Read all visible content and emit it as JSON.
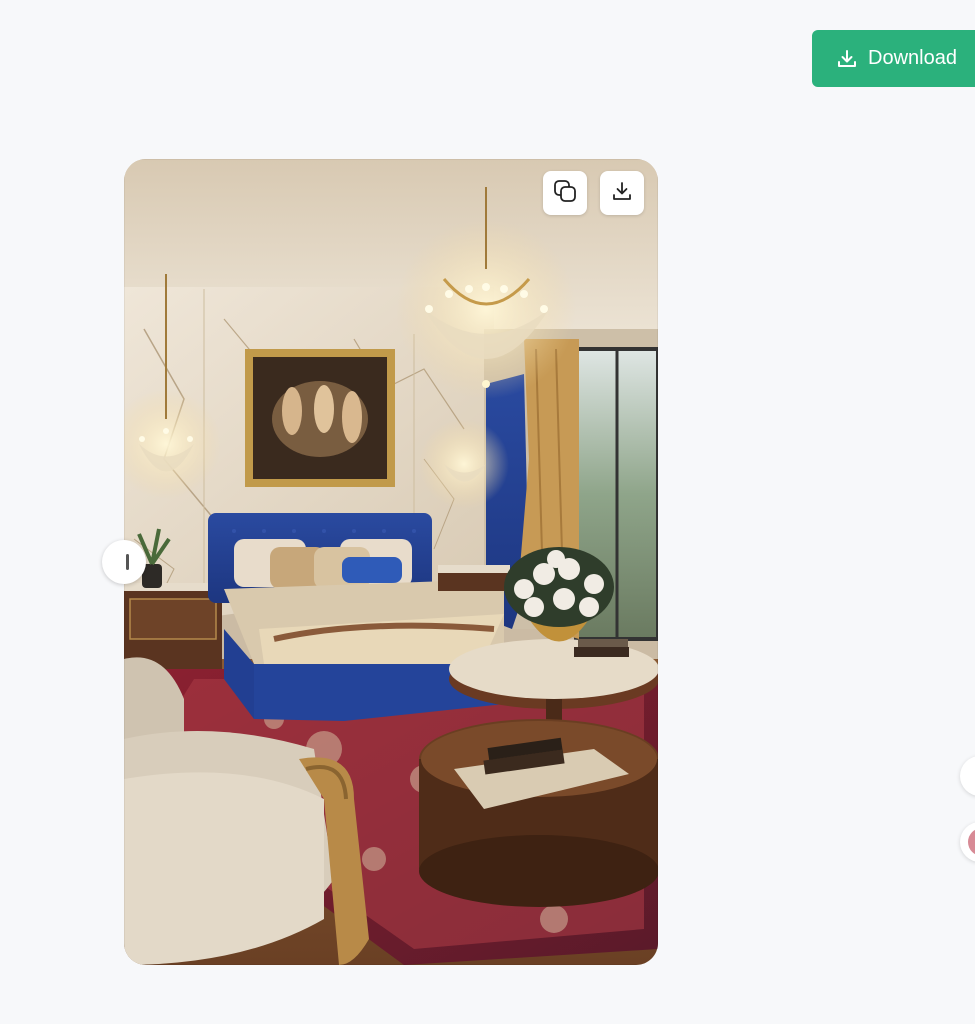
{
  "toolbar": {
    "download_label": "Download"
  },
  "image_card": {
    "overlay_buttons": [
      {
        "icon": "copy-icon"
      },
      {
        "icon": "download-icon"
      }
    ]
  },
  "colors": {
    "accent": "#2bb17c",
    "background": "#f7f8fa"
  }
}
